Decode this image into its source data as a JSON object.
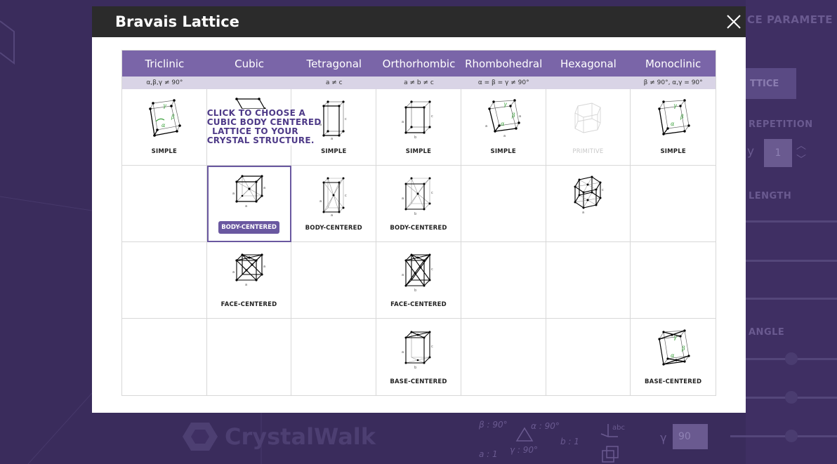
{
  "background": {
    "panel_title": "CE PARAMETE",
    "lattice_button": "TTICE",
    "repetition_label": "REPETITION",
    "y_axis_label": "y",
    "y_repetition_value": "1",
    "length_label": "LENGTH",
    "angle_label": "ANGLE",
    "logo_text": "CrystalWalk",
    "beta_readout": "β : 90°",
    "alpha_readout": "α : 90°",
    "gamma_readout": "γ : 90°",
    "a_readout": "a : 1",
    "b_readout": "b : 1",
    "gamma_input_label": "γ",
    "gamma_input_value": "90"
  },
  "modal": {
    "title": "Bravais Lattice",
    "close_icon": "close-icon",
    "columns": [
      {
        "name": "Triclinic",
        "constraint": "α,β,γ ≠ 90°"
      },
      {
        "name": "Cubic",
        "constraint": ""
      },
      {
        "name": "Tetragonal",
        "constraint": "a ≠ c"
      },
      {
        "name": "Orthorhombic",
        "constraint": "a ≠ b ≠ c"
      },
      {
        "name": "Rhombohedral",
        "constraint": "α = β = γ ≠ 90°"
      },
      {
        "name": "Hexagonal",
        "constraint": ""
      },
      {
        "name": "Monoclinic",
        "constraint": "β ≠ 90°, α,γ = 90°"
      }
    ],
    "labels": {
      "simple": "SIMPLE",
      "primitive": "PRIMITIVE",
      "body_centered": "BODY-CENTERED",
      "face_centered": "FACE-CENTERED",
      "base_centered": "BASE-CENTERED"
    },
    "callout": {
      "line1": "CLICK TO CHOOSE A",
      "line2": "CUBIC BODY CENTERED",
      "line3": "LATTICE TO YOUR",
      "line4": "CRYSTAL STRUCTURE."
    },
    "selected": {
      "column": "Cubic",
      "type": "BODY-CENTERED"
    }
  },
  "colors": {
    "header_bar": "#2b2b2b",
    "column_header": "#7a65a8",
    "subheader": "#d9d4e6",
    "accent": "#6a58a0",
    "lattice_green": "#3aa03a"
  }
}
